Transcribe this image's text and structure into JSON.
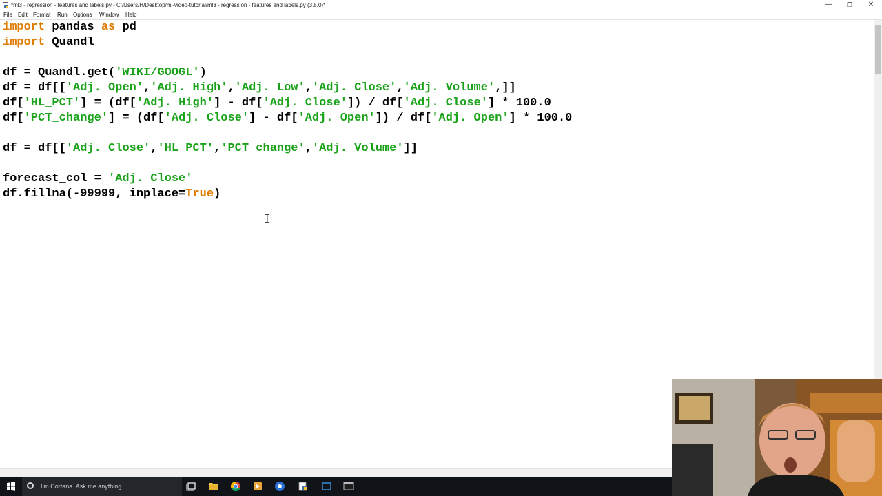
{
  "window": {
    "title": "*ml3 - regression - features and labels.py - C:/Users/H/Desktop/ml-video-tutorial/ml3 - regression - features and labels.py (3.5.0)*",
    "controls": {
      "minimize": "—",
      "maximize": "❐",
      "close": "✕"
    }
  },
  "menu": {
    "items": [
      "File",
      "Edit",
      "Format",
      "Run",
      "Options",
      "Window",
      "Help"
    ]
  },
  "editor": {
    "lines": [
      [
        {
          "t": "import",
          "c": "kw"
        },
        {
          "t": " pandas "
        },
        {
          "t": "as",
          "c": "kw"
        },
        {
          "t": " pd"
        }
      ],
      [
        {
          "t": "import",
          "c": "kw"
        },
        {
          "t": " Quandl"
        }
      ],
      [],
      [
        {
          "t": "df = Quandl.get("
        },
        {
          "t": "'WIKI/GOOGL'",
          "c": "str"
        },
        {
          "t": ")"
        }
      ],
      [
        {
          "t": "df = df[["
        },
        {
          "t": "'Adj. Open'",
          "c": "str"
        },
        {
          "t": ","
        },
        {
          "t": "'Adj. High'",
          "c": "str"
        },
        {
          "t": ","
        },
        {
          "t": "'Adj. Low'",
          "c": "str"
        },
        {
          "t": ","
        },
        {
          "t": "'Adj. Close'",
          "c": "str"
        },
        {
          "t": ","
        },
        {
          "t": "'Adj. Volume'",
          "c": "str"
        },
        {
          "t": ",]]"
        }
      ],
      [
        {
          "t": "df["
        },
        {
          "t": "'HL_PCT'",
          "c": "str"
        },
        {
          "t": "] = (df["
        },
        {
          "t": "'Adj. High'",
          "c": "str"
        },
        {
          "t": "] - df["
        },
        {
          "t": "'Adj. Close'",
          "c": "str"
        },
        {
          "t": "]) / df["
        },
        {
          "t": "'Adj. Close'",
          "c": "str"
        },
        {
          "t": "] * 100.0"
        }
      ],
      [
        {
          "t": "df["
        },
        {
          "t": "'PCT_change'",
          "c": "str"
        },
        {
          "t": "] = (df["
        },
        {
          "t": "'Adj. Close'",
          "c": "str"
        },
        {
          "t": "] - df["
        },
        {
          "t": "'Adj. Open'",
          "c": "str"
        },
        {
          "t": "]) / df["
        },
        {
          "t": "'Adj. Open'",
          "c": "str"
        },
        {
          "t": "] * 100.0"
        }
      ],
      [],
      [
        {
          "t": "df = df[["
        },
        {
          "t": "'Adj. Close'",
          "c": "str"
        },
        {
          "t": ","
        },
        {
          "t": "'HL_PCT'",
          "c": "str"
        },
        {
          "t": ","
        },
        {
          "t": "'PCT_change'",
          "c": "str"
        },
        {
          "t": ","
        },
        {
          "t": "'Adj. Volume'",
          "c": "str"
        },
        {
          "t": "]]"
        }
      ],
      [],
      [
        {
          "t": "forecast_col = "
        },
        {
          "t": "'Adj. Close'",
          "c": "str"
        }
      ],
      [
        {
          "t": "df.fillna(-99999, inplace="
        },
        {
          "t": "True",
          "c": "kw"
        },
        {
          "t": ")"
        }
      ]
    ]
  },
  "taskbar": {
    "search_placeholder": "I'm Cortana. Ask me anything.",
    "icons": [
      "task-view-icon",
      "file-explorer-icon",
      "chrome-icon",
      "media-player-icon",
      "chrome-icon",
      "idle-editor-icon",
      "window-icon",
      "terminal-icon"
    ],
    "accent": "#76b9ed"
  },
  "colors": {
    "keyword": "#e07b00",
    "string": "#1aa31a",
    "taskbar": "#101418"
  }
}
